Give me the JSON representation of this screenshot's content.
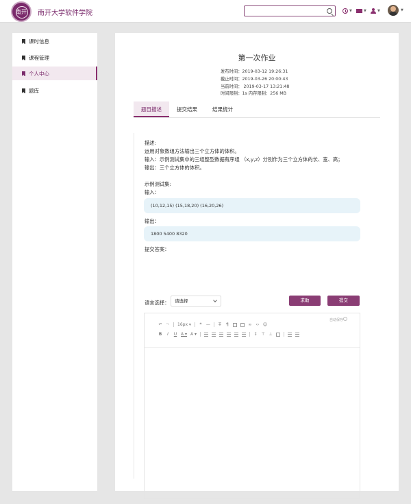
{
  "header": {
    "school_name": "南开大学软件学院",
    "logo_glyph": "南开",
    "search": {
      "value": "",
      "placeholder": ""
    }
  },
  "sidebar": {
    "items": [
      {
        "label": "课时信息",
        "active": false
      },
      {
        "label": "课程管理",
        "active": false
      },
      {
        "label": "个人中心",
        "active": true
      },
      {
        "label": "题库",
        "active": false
      }
    ]
  },
  "assignment": {
    "title": "第一次作业",
    "published": "发布时间：2019-03-12 19:26:31",
    "deadline": "截止时间：2019-03-26 20:00:43",
    "current": "当前时间： 2019-03-17 13:21:48",
    "limits": "时间限制：1s  内存限制：256 MB"
  },
  "tabs": [
    {
      "label": "题目描述",
      "active": true
    },
    {
      "label": "提交结果",
      "active": false
    },
    {
      "label": "结果统计",
      "active": false
    }
  ],
  "problem": {
    "desc_heading": "描述:",
    "desc_line1": "运用对象数组方法输出三个立方体的体积。",
    "desc_line2": "输入：示例测试集中的三组整型数据有序组 （x,y,z）分别作为三个立方体的长、宽、高；",
    "desc_line3": "输出：三个立方体的体积。",
    "sample_heading": "示例测试集:",
    "input_label": "输入：",
    "input_value": "(10,12,15) (15,18,20) (16,20,26)",
    "output_label": "输出：",
    "output_value": "1800 5400 8320",
    "submit_answer_label": "提交答案："
  },
  "controls": {
    "lang_label": "语言选择：",
    "lang_selected": "请选择",
    "help_button": "求助",
    "submit_button": "提交",
    "autosave_label": "自动保存",
    "font_size": "16px"
  },
  "colors": {
    "brand": "#8a3d74",
    "active_bg": "#f2e8ef",
    "io_bg": "#e7f3f9"
  }
}
